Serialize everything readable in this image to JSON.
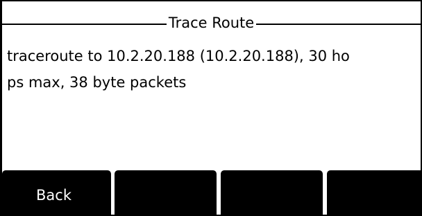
{
  "screen": {
    "title": "Trace Route",
    "message_lines": [
      "traceroute to 10.2.20.188 (10.2.20.188), 30 ho",
      "ps max, 38 byte packets"
    ]
  },
  "softkeys": [
    {
      "label": "Back"
    },
    {
      "label": ""
    },
    {
      "label": ""
    },
    {
      "label": ""
    }
  ],
  "colors": {
    "background": "#ffffff",
    "foreground": "#000000",
    "softkey_bg": "#000000",
    "softkey_text": "#ffffff"
  }
}
